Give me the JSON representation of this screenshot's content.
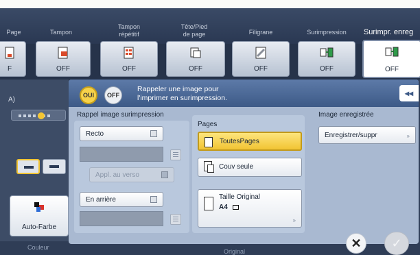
{
  "tabs": [
    {
      "label": "Page"
    },
    {
      "label": "Tampon"
    },
    {
      "label": "Tampon\nrépétitif"
    },
    {
      "label": "Tête/Pied\nde page"
    },
    {
      "label": "Filigrane"
    },
    {
      "label": "Surimpression"
    },
    {
      "label": "Surimpr. enreg"
    }
  ],
  "tiles": {
    "values": [
      "F",
      "OFF",
      "OFF",
      "OFF",
      "OFF",
      "OFF",
      "OFF"
    ]
  },
  "dialog": {
    "oui_label": "OUI",
    "off_label": "OFF",
    "description": "Rappeler une image pour l'imprimer en surimpression.",
    "recall_section": {
      "title": "Rappel image surimpression",
      "side_button": "Recto",
      "apply_back_button": "Appl. au verso",
      "layer_button": "En arrière"
    },
    "pages_section": {
      "title": "Pages",
      "all_pages": "ToutesPages",
      "cover_only": "Couv seule",
      "size_title": "Taille Original",
      "size_value": "A4"
    },
    "registered_section": {
      "title": "Image enregistrée",
      "register_button": "Enregistrer/suppr"
    }
  },
  "left": {
    "a_label": "A)",
    "color_button": "Auto-Farbe"
  },
  "bottom_labels": {
    "couleur": "Couleur",
    "original": "Original"
  },
  "colors": {
    "accent_yellow": "#f2c433",
    "header_blue": "#3d5a87",
    "dialog_bg": "#a9b9d1"
  }
}
